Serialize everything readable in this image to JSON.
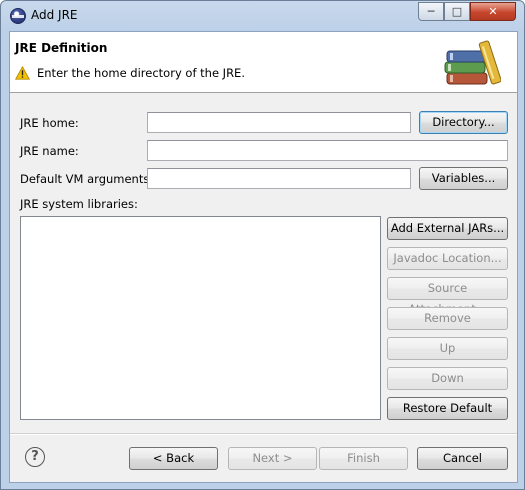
{
  "window": {
    "title": "Add JRE",
    "min_glyph": "─",
    "max_glyph": "□",
    "close_glyph": "✕"
  },
  "header": {
    "title": "JRE Definition",
    "message": "Enter the home directory of the JRE."
  },
  "form": {
    "jre_home_label": "JRE home:",
    "jre_home_value": "",
    "directory_button": "Directory...",
    "jre_name_label": "JRE name:",
    "jre_name_value": "",
    "vm_args_label": "Default VM arguments:",
    "vm_args_value": "",
    "variables_button": "Variables...",
    "libraries_label": "JRE system libraries:",
    "libraries": []
  },
  "library_buttons": {
    "add_external": "Add External JARs...",
    "javadoc": "Javadoc Location...",
    "source": "Source Attachment...",
    "remove": "Remove",
    "up": "Up",
    "down": "Down",
    "restore": "Restore Default"
  },
  "footer": {
    "help_glyph": "?",
    "back": "< Back",
    "next": "Next >",
    "finish": "Finish",
    "cancel": "Cancel"
  },
  "icons": {
    "app": "eclipse-icon",
    "warning": "warning-icon",
    "banner": "library-books-icon",
    "help": "help-icon"
  },
  "colors": {
    "accent": "#3c7fb1",
    "close": "#c7452d",
    "warning": "#f2c200"
  }
}
